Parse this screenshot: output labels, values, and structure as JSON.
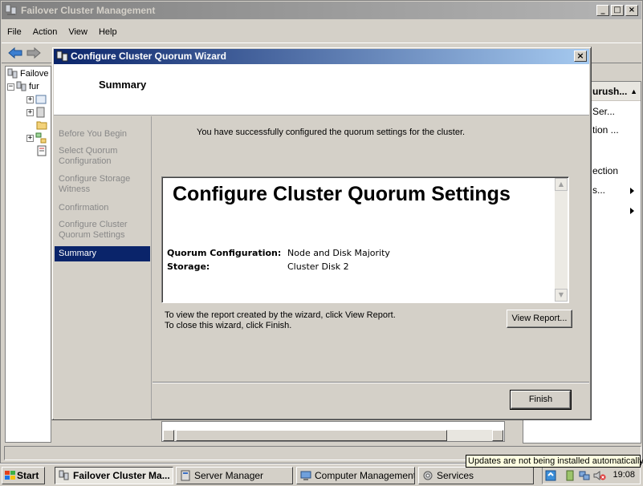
{
  "app": {
    "title": "Failover Cluster Management",
    "menu": [
      "File",
      "Action",
      "View",
      "Help"
    ],
    "tree": {
      "root_label": "Failove",
      "child_label": "fur"
    }
  },
  "actions_pane": {
    "header": "urush...",
    "items": [
      "Ser...",
      "tion ...",
      "ection",
      "s..."
    ]
  },
  "wizard": {
    "title": "Configure Cluster Quorum Wizard",
    "page_heading": "Summary",
    "nav": [
      "Before You Begin",
      "Select Quorum Configuration",
      "Configure Storage Witness",
      "Confirmation",
      "Configure Cluster Quorum Settings",
      "Summary"
    ],
    "active_step": "Summary",
    "success_text": "You have successfully configured the quorum settings for the cluster.",
    "report": {
      "title": "Configure Cluster Quorum Settings",
      "rows": [
        {
          "key": "Quorum Configuration:",
          "value": "Node and Disk Majority"
        },
        {
          "key": "Storage:",
          "value": "Cluster Disk 2"
        }
      ]
    },
    "hint_line1": "To view the report created by the wizard, click View Report.",
    "hint_line2": "To close this wizard, click Finish.",
    "view_report_label": "View Report...",
    "finish_label": "Finish",
    "close_glyph": "×"
  },
  "taskbar": {
    "start_label": "Start",
    "tasks": [
      "Failover Cluster Ma...",
      "Server Manager",
      "Computer Management",
      "Services"
    ],
    "clock": "19:08",
    "tooltip": "Updates are not being installed automatically"
  },
  "colors": {
    "title_active": "#0a246a",
    "title_inactive": "#808080",
    "face": "#d4d0c8",
    "selection": "#0a246a"
  }
}
